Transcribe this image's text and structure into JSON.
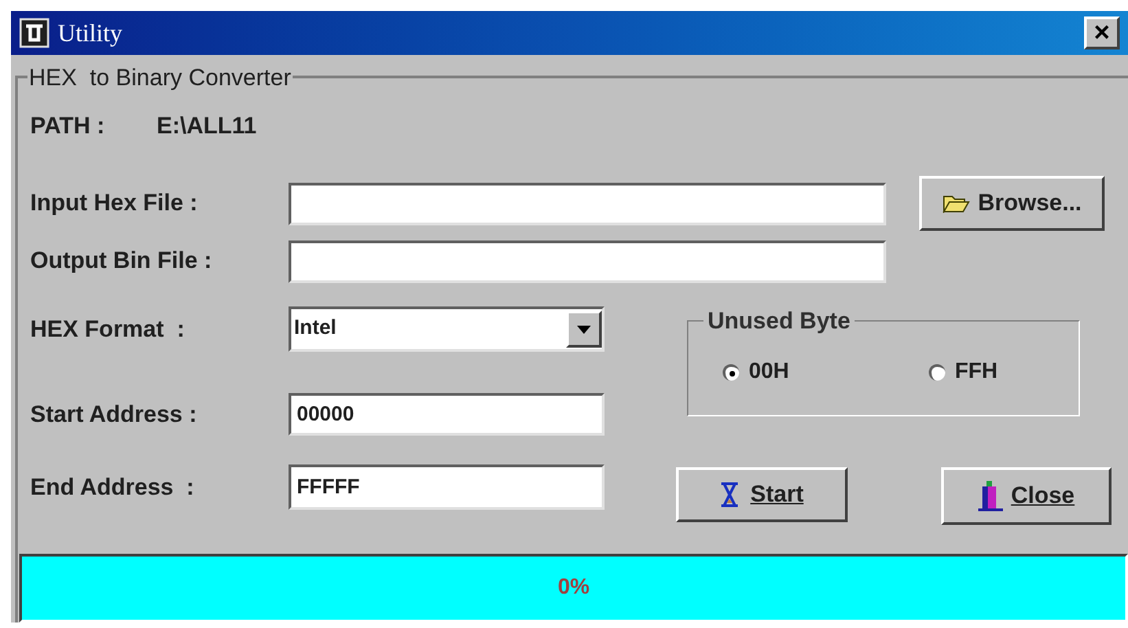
{
  "window": {
    "title": "Utility",
    "close": "×"
  },
  "group_title": "HEX  to Binary Converter",
  "path": {
    "label": "PATH :",
    "value": "E:\\ALL11"
  },
  "input_hex_file": {
    "label": "Input Hex File :"
  },
  "output_bin_file": {
    "label": "Output Bin File :"
  },
  "browse_button": "Browse...",
  "hex_format": {
    "label": "HEX Format  :",
    "value": "Intel"
  },
  "unused_byte": {
    "title": "Unused Byte",
    "options": [
      {
        "label": "00H",
        "selected": true
      },
      {
        "label": "FFH",
        "selected": false
      }
    ]
  },
  "start_address": {
    "label": "Start Address :",
    "value": "00000"
  },
  "end_address": {
    "label": "End Address  :",
    "value": "FFFFF"
  },
  "start_button": "Start",
  "close_button": "Close",
  "progress": {
    "reading": "0%"
  }
}
